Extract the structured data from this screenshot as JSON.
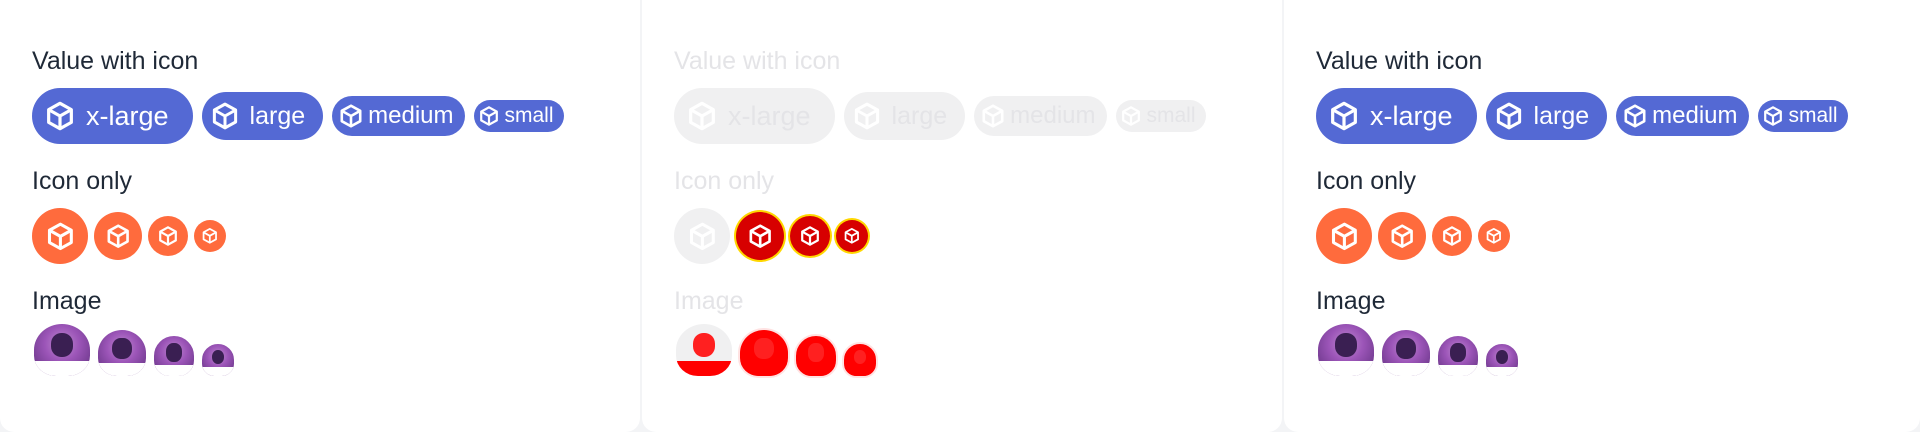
{
  "panels": [
    {
      "id": "default",
      "headings": {
        "value_with_icon": "Value with icon",
        "icon_only": "Icon only",
        "image": "Image"
      },
      "chips": [
        "x-large",
        "large",
        "medium",
        "small"
      ]
    },
    {
      "id": "disabled",
      "headings": {
        "value_with_icon": "Value with icon",
        "icon_only": "Icon only",
        "image": "Image"
      },
      "chips": [
        "x-large",
        "large",
        "medium",
        "small"
      ]
    },
    {
      "id": "alt",
      "headings": {
        "value_with_icon": "Value with icon",
        "icon_only": "Icon only",
        "image": "Image"
      },
      "chips": [
        "x-large",
        "large",
        "medium",
        "small"
      ]
    }
  ],
  "icons": {
    "chip_icon": "cube-icon",
    "avatar": "user-photo"
  },
  "colors": {
    "chip": "#5469d4",
    "icon_circle": "#ff6b3d",
    "disabled": "#f0f0f1",
    "error": "#d70000"
  }
}
